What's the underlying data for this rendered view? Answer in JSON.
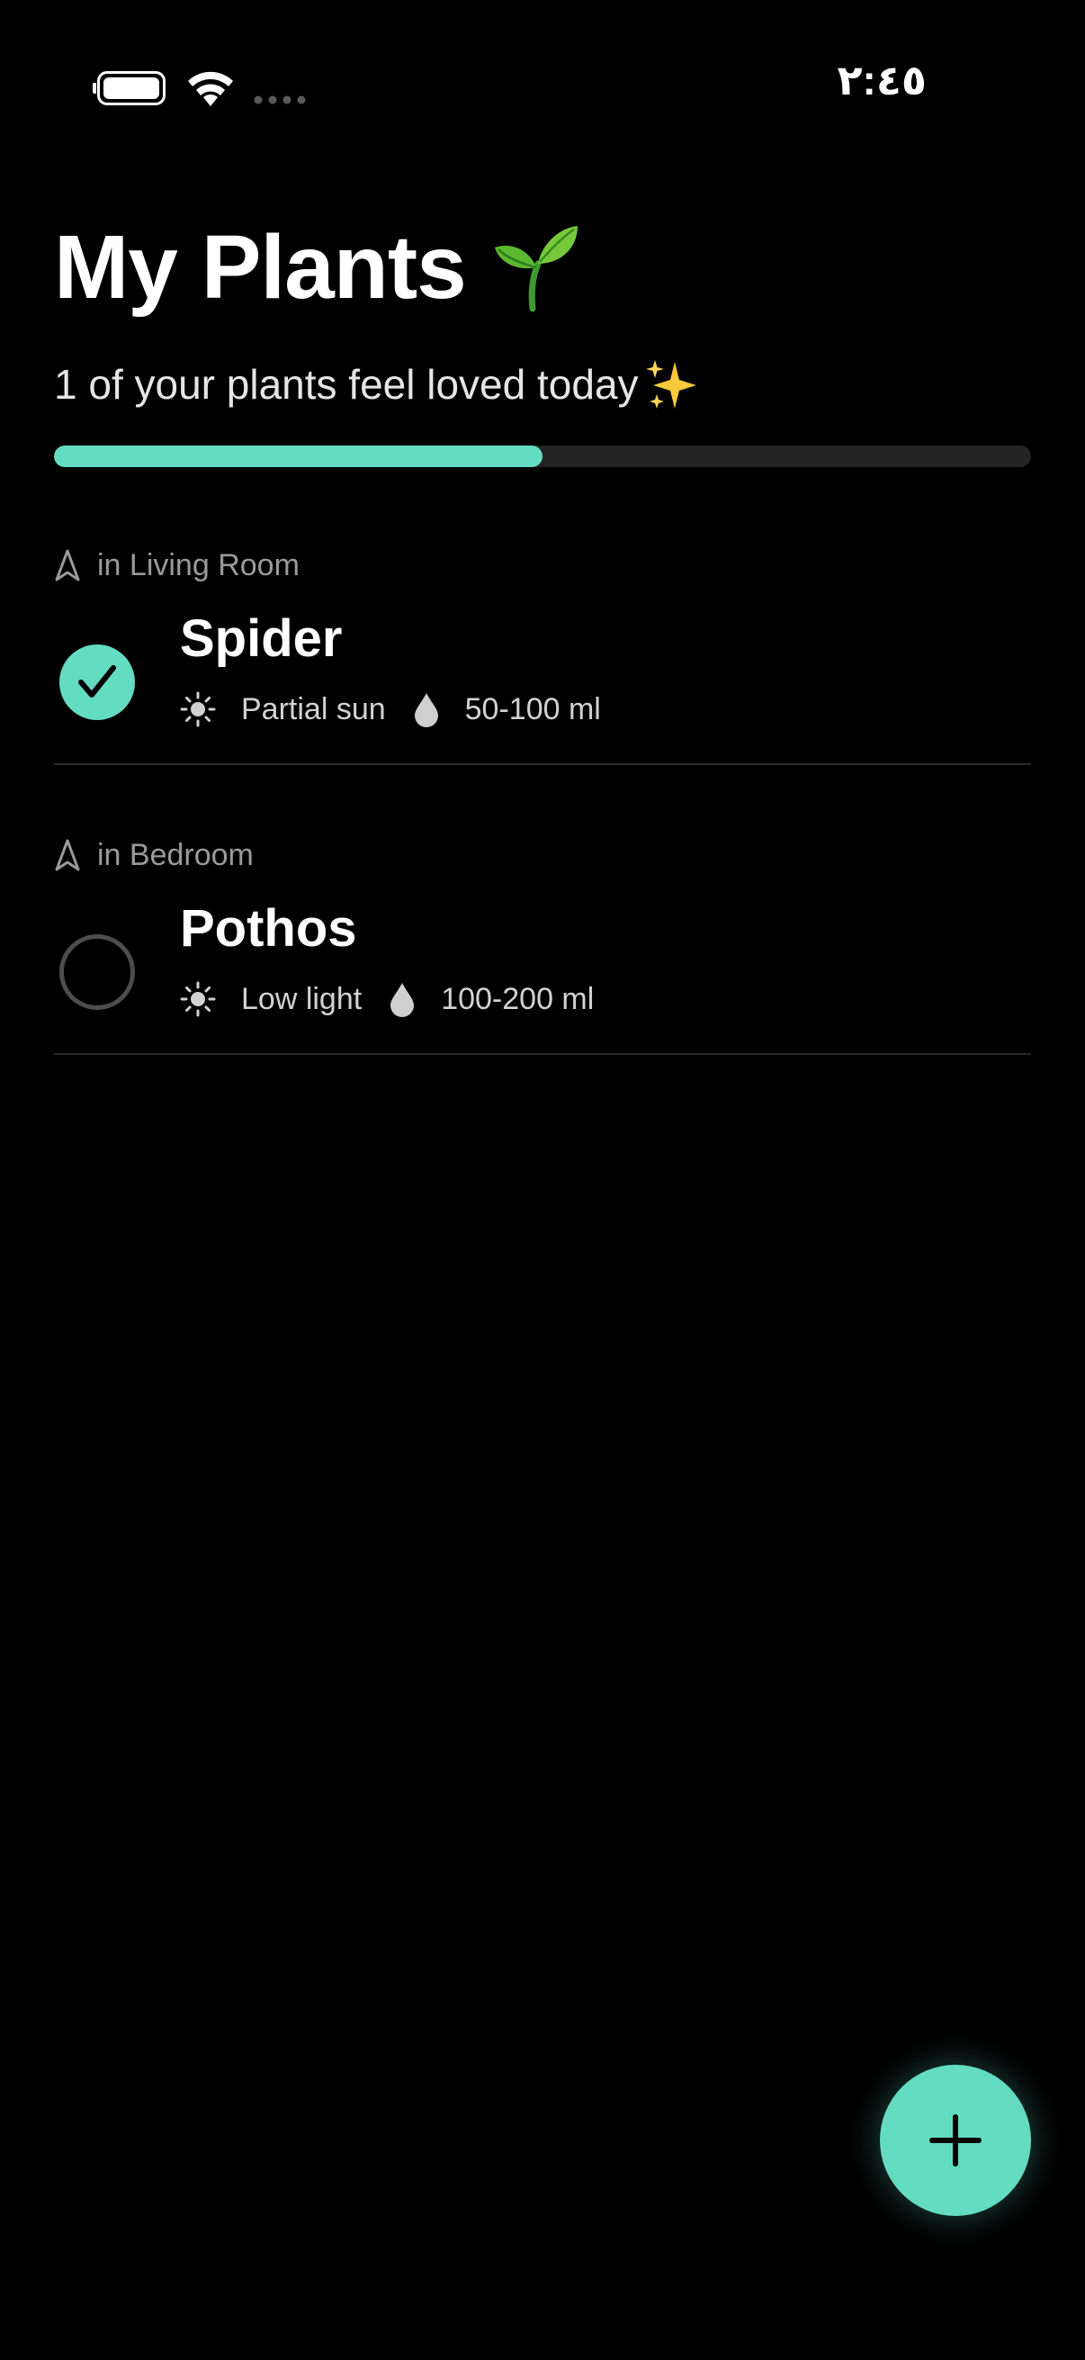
{
  "status_bar": {
    "time": "٢:٤٥"
  },
  "header": {
    "title": "My Plants",
    "title_emoji": "seedling-icon",
    "subtitle": "1 of your plants feel loved today",
    "subtitle_emoji": "sparkles-icon"
  },
  "progress": {
    "completed": 1,
    "total": 2,
    "fraction": 0.5,
    "fill_color": "#63dcc2",
    "track_color": "#232323"
  },
  "plants": [
    {
      "room": "in Living Room",
      "name": "Spider",
      "light": "Partial sun",
      "water": "50-100 ml",
      "done": true
    },
    {
      "room": "in Bedroom",
      "name": "Pothos",
      "light": "Low light",
      "water": "100-200 ml",
      "done": false
    }
  ],
  "icons": {
    "room": "location-arrow-icon",
    "light": "sun-icon",
    "water": "water-drop-icon",
    "check": "checkmark-icon",
    "add": "plus-icon"
  },
  "colors": {
    "accent": "#63dcc2",
    "background": "#000000"
  }
}
